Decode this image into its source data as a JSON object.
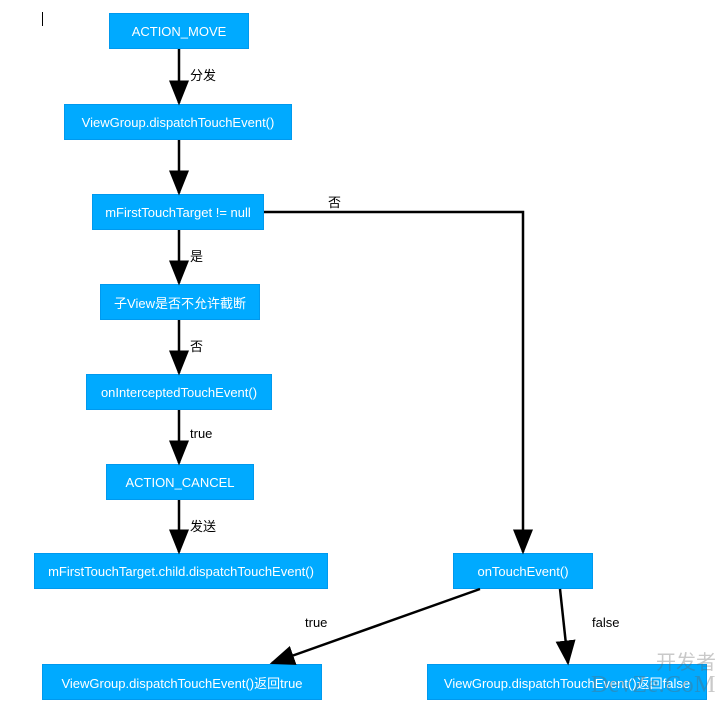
{
  "nodes": {
    "n1": "ACTION_MOVE",
    "n2": "ViewGroup.dispatchTouchEvent()",
    "n3": "mFirstTouchTarget != null",
    "n4": "子View是否不允许截断",
    "n5": "onInterceptedTouchEvent()",
    "n6": "ACTION_CANCEL",
    "n7": "mFirstTouchTarget.child.dispatchTouchEvent()",
    "n8": "onTouchEvent()",
    "n9": "ViewGroup.dispatchTouchEvent()返回true",
    "n10": "ViewGroup.dispatchTouchEvent()返回false"
  },
  "edges": {
    "e1": "分发",
    "e2": "否",
    "e3": "是",
    "e4": "否",
    "e5": "true",
    "e6": "发送",
    "e7": "true",
    "e8": "false"
  },
  "watermark": {
    "line1": "开发者",
    "line2": "DevZe.CoM"
  },
  "colors": {
    "node_bg": "#00aaff",
    "node_text": "#ffffff",
    "arrow": "#000000"
  }
}
